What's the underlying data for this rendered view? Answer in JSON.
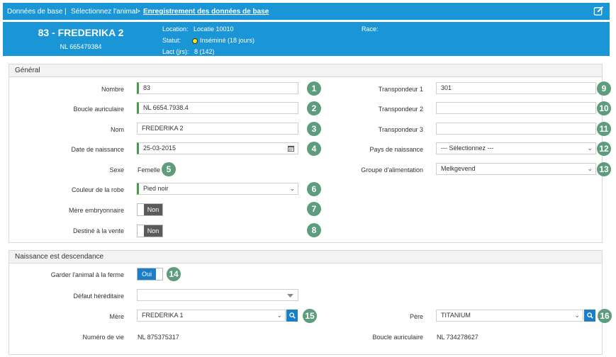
{
  "breadcrumb": {
    "item1": "Données de base",
    "sep1": "|",
    "item2": "Sélectionnez l'animal",
    "sep2": ">",
    "item3": "Enregistrement des données de base"
  },
  "header": {
    "title": "83 - FREDERIKA 2",
    "subtitle": "NL 665479384",
    "location_label": "Location:",
    "location_value": "Locatie 10010",
    "status_label": "Statut:",
    "status_value": "Inséminé (18 jours)",
    "lact_label": "Lact (jrs):",
    "lact_value": "8 (142)",
    "race_label": "Race:",
    "status_color": "#f5e80f"
  },
  "general": {
    "title": "Général",
    "nombre": {
      "label": "Nombre",
      "value": "83",
      "badge": "1"
    },
    "boucle": {
      "label": "Boucle auriculaire",
      "value": "NL 6654.7938.4",
      "badge": "2"
    },
    "nom": {
      "label": "Nom",
      "value": "FREDERIKA 2",
      "badge": "3"
    },
    "date": {
      "label": "Date de naissance",
      "value": "25-03-2015",
      "badge": "4"
    },
    "sexe": {
      "label": "Sexe",
      "value": "Femelle",
      "badge": "5"
    },
    "couleur": {
      "label": "Couleur de la robe",
      "value": "Pied noir",
      "badge": "6"
    },
    "mere_embryo": {
      "label": "Mère embryonnaire",
      "value": "Non",
      "badge": "7"
    },
    "destine": {
      "label": "Destiné à la vente",
      "value": "Non",
      "badge": "8"
    },
    "transpondeur1": {
      "label": "Transpondeur 1",
      "value": "301",
      "badge": "9"
    },
    "transpondeur2": {
      "label": "Transpondeur 2",
      "value": "",
      "badge": "10"
    },
    "transpondeur3": {
      "label": "Transpondeur 3",
      "value": "",
      "badge": "11"
    },
    "pays": {
      "label": "Pays de naissance",
      "value": "--- Sélectionnez ---",
      "badge": "12"
    },
    "groupe": {
      "label": "Groupe d'alimentation",
      "value": "Melkgevend",
      "badge": "13"
    }
  },
  "birth": {
    "title": "Naissance est descendance",
    "garder": {
      "label": "Garder l'animal à la ferme",
      "value": "Oui",
      "badge": "14"
    },
    "defaut": {
      "label": "Défaut héréditaire",
      "value": ""
    },
    "mere": {
      "label": "Mère",
      "value": "FREDERIKA 1",
      "badge": "15"
    },
    "pere": {
      "label": "Père",
      "value": "TITANIUM",
      "badge": "16"
    },
    "numero": {
      "label": "Numéro de vie",
      "value": "NL 875375317"
    },
    "boucle_pere": {
      "label": "Boucle auriculaire",
      "value": "NL 734278627"
    }
  },
  "colors": {
    "brand": "#1a95d6",
    "badge": "#5e9c7e",
    "required": "#43a047",
    "toggle_on": "#1a7fc6",
    "toggle_off": "#5a5a5a"
  },
  "icons": {
    "edit": "edit-icon",
    "calendar": "calendar-icon",
    "search": "search-icon",
    "dropdown": "chevron-down-icon"
  }
}
